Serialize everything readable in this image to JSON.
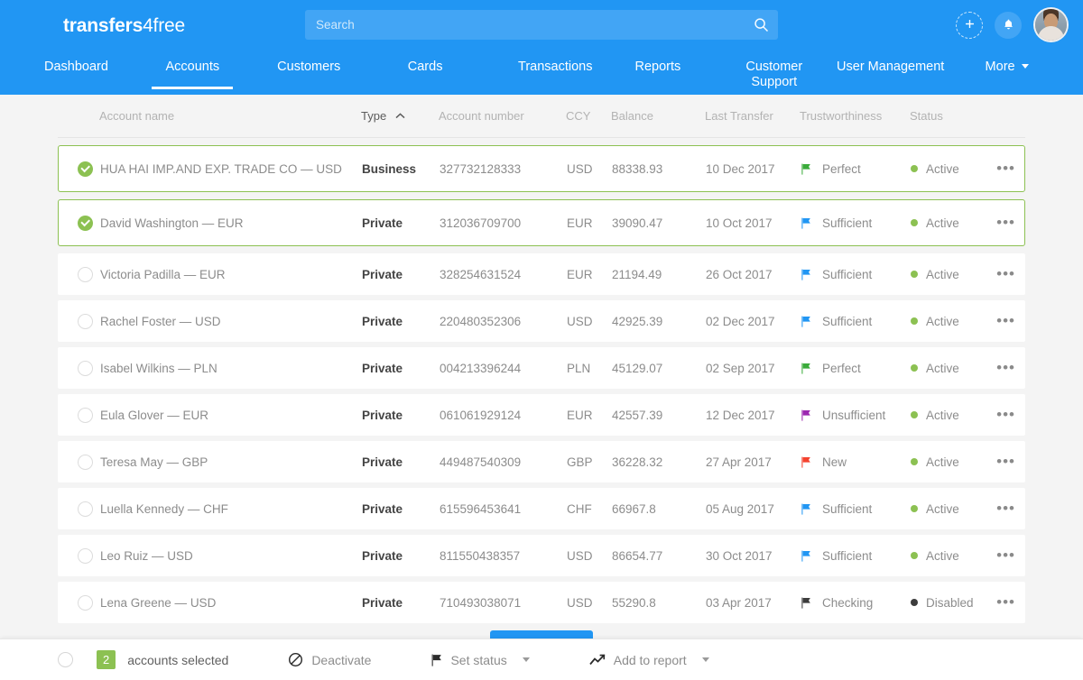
{
  "brand": {
    "name_bold": "transfers",
    "name_light": "4free",
    "accent": "#2196f3",
    "green": "#8cc152"
  },
  "header": {
    "search": {
      "placeholder": "Search",
      "value": ""
    },
    "add_label": "+",
    "icons": [
      "plus-icon",
      "bell-icon",
      "avatar"
    ]
  },
  "nav": {
    "items": [
      {
        "label": "Dashboard",
        "active": false
      },
      {
        "label": "Accounts",
        "active": true
      },
      {
        "label": "Customers",
        "active": false
      },
      {
        "label": "Cards",
        "active": false
      },
      {
        "label": "Transactions",
        "active": false
      },
      {
        "label": "Reports",
        "active": false
      },
      {
        "label": "Customer Support",
        "active": false
      },
      {
        "label": "User Management",
        "active": false
      },
      {
        "label": "More",
        "active": false,
        "caret": true
      }
    ]
  },
  "table": {
    "columns": [
      {
        "key": "name",
        "label": "Account name",
        "sorted": false
      },
      {
        "key": "type",
        "label": "Type",
        "sorted": true,
        "sort_dir": "asc"
      },
      {
        "key": "account_number",
        "label": "Account number",
        "sorted": false
      },
      {
        "key": "ccy",
        "label": "CCY",
        "sorted": false
      },
      {
        "key": "balance",
        "label": "Balance",
        "sorted": false
      },
      {
        "key": "last_transfer",
        "label": "Last Transfer",
        "sorted": false
      },
      {
        "key": "trustworthiness",
        "label": "Trustworthiness",
        "sorted": false
      },
      {
        "key": "status",
        "label": "Status",
        "sorted": false
      }
    ],
    "row_menu_label": "•••",
    "rows": [
      {
        "selected": true,
        "name": "HUA HAI IMP.AND EXP. TRADE CO — USD",
        "type": "Business",
        "account_number": "327732128333",
        "ccy": "USD",
        "balance": "88338.93",
        "last_transfer": "10 Dec 2017",
        "trustworthiness": "Perfect",
        "trust_color": "#3aab3a",
        "status": "Active",
        "status_color": "#8cc152"
      },
      {
        "selected": true,
        "name": "David Washington — EUR",
        "type": "Private",
        "account_number": "312036709700",
        "ccy": "EUR",
        "balance": "39090.47",
        "last_transfer": "10 Oct 2017",
        "trustworthiness": "Sufficient",
        "trust_color": "#2196f3",
        "status": "Active",
        "status_color": "#8cc152"
      },
      {
        "selected": false,
        "name": "Victoria Padilla — EUR",
        "type": "Private",
        "account_number": "328254631524",
        "ccy": "EUR",
        "balance": "21194.49",
        "last_transfer": "26 Oct 2017",
        "trustworthiness": "Sufficient",
        "trust_color": "#2196f3",
        "status": "Active",
        "status_color": "#8cc152"
      },
      {
        "selected": false,
        "name": "Rachel Foster — USD",
        "type": "Private",
        "account_number": "220480352306",
        "ccy": "USD",
        "balance": "42925.39",
        "last_transfer": "02 Dec 2017",
        "trustworthiness": "Sufficient",
        "trust_color": "#2196f3",
        "status": "Active",
        "status_color": "#8cc152"
      },
      {
        "selected": false,
        "name": "Isabel Wilkins — PLN",
        "type": "Private",
        "account_number": "004213396244",
        "ccy": "PLN",
        "balance": "45129.07",
        "last_transfer": "02 Sep 2017",
        "trustworthiness": "Perfect",
        "trust_color": "#3aab3a",
        "status": "Active",
        "status_color": "#8cc152"
      },
      {
        "selected": false,
        "name": "Eula Glover — EUR",
        "type": "Private",
        "account_number": "061061929124",
        "ccy": "EUR",
        "balance": "42557.39",
        "last_transfer": "12 Dec 2017",
        "trustworthiness": "Unsufficient",
        "trust_color": "#9c27b0",
        "status": "Active",
        "status_color": "#8cc152"
      },
      {
        "selected": false,
        "name": "Teresa May — GBP",
        "type": "Private",
        "account_number": "449487540309",
        "ccy": "GBP",
        "balance": "36228.32",
        "last_transfer": "27 Apr 2017",
        "trustworthiness": "New",
        "trust_color": "#f4422e",
        "status": "Active",
        "status_color": "#8cc152"
      },
      {
        "selected": false,
        "name": "Luella Kennedy — CHF",
        "type": "Private",
        "account_number": "615596453641",
        "ccy": "CHF",
        "balance": "66967.8",
        "last_transfer": "05 Aug 2017",
        "trustworthiness": "Sufficient",
        "trust_color": "#2196f3",
        "status": "Active",
        "status_color": "#8cc152"
      },
      {
        "selected": false,
        "name": "Leo Ruiz — USD",
        "type": "Private",
        "account_number": "811550438357",
        "ccy": "USD",
        "balance": "86654.77",
        "last_transfer": "30 Oct 2017",
        "trustworthiness": "Sufficient",
        "trust_color": "#2196f3",
        "status": "Active",
        "status_color": "#8cc152"
      },
      {
        "selected": false,
        "name": "Lena Greene — USD",
        "type": "Private",
        "account_number": "710493038071",
        "ccy": "USD",
        "balance": "55290.8",
        "last_transfer": "03 Apr 2017",
        "trustworthiness": "Checking",
        "trust_color": "#3c3c3c",
        "status": "Disabled",
        "status_color": "#3c3c3c"
      }
    ]
  },
  "load_more": {
    "label": ""
  },
  "bottom_bar": {
    "selected_count": "2",
    "selected_text": "accounts selected",
    "actions": [
      {
        "label": "Deactivate",
        "icon": "block-icon",
        "caret": false
      },
      {
        "label": "Set status",
        "icon": "flag-icon",
        "caret": true
      },
      {
        "label": "Add to report",
        "icon": "trend-up-icon",
        "caret": true
      }
    ]
  }
}
